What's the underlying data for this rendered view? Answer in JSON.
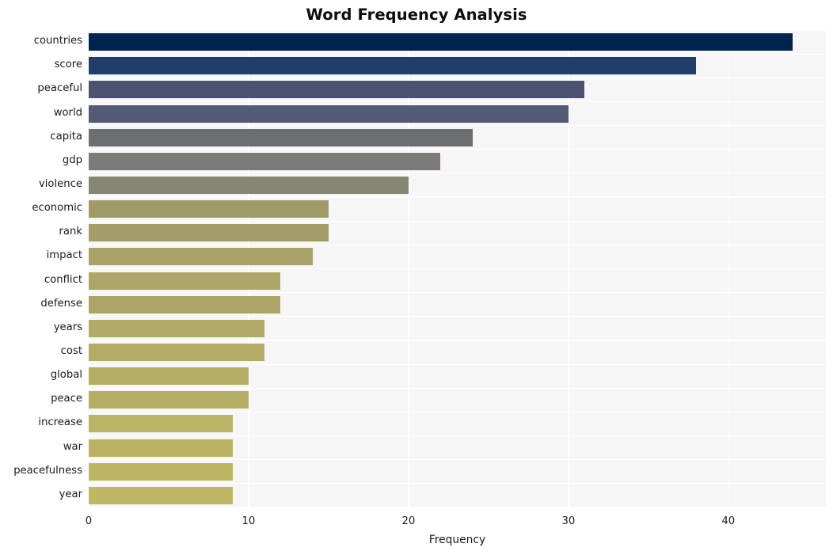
{
  "chart_data": {
    "type": "bar",
    "orientation": "horizontal",
    "title": "Word Frequency Analysis",
    "xlabel": "Frequency",
    "ylabel": "",
    "categories": [
      "countries",
      "score",
      "peaceful",
      "world",
      "capita",
      "gdp",
      "violence",
      "economic",
      "rank",
      "impact",
      "conflict",
      "defense",
      "years",
      "cost",
      "global",
      "peace",
      "increase",
      "war",
      "peacefulness",
      "year"
    ],
    "values": [
      44,
      38,
      31,
      30,
      24,
      22,
      20,
      15,
      15,
      14,
      12,
      12,
      11,
      11,
      10,
      10,
      9,
      9,
      9,
      9
    ],
    "colors": [
      "#00224e",
      "#213d6b",
      "#4c5272",
      "#545a76",
      "#6d6e72",
      "#7c7b78",
      "#878672",
      "#a09a6b",
      "#a39d6a",
      "#a9a269",
      "#ada668",
      "#ada668",
      "#b1aa67",
      "#b2ab66",
      "#b5ae65",
      "#b5ae65",
      "#bbb365",
      "#bbb364",
      "#bdb564",
      "#bfb764"
    ],
    "xlim": [
      0,
      46.1
    ],
    "xticks": [
      0,
      10,
      20,
      30,
      40
    ],
    "xticklabels": [
      "0",
      "10",
      "20",
      "30",
      "40"
    ],
    "grid": true,
    "grid_color": "#ffffff",
    "plot_background": "#f6f6f7",
    "figure_background": "#ffffff",
    "legend": null,
    "colormap": "cividis"
  }
}
